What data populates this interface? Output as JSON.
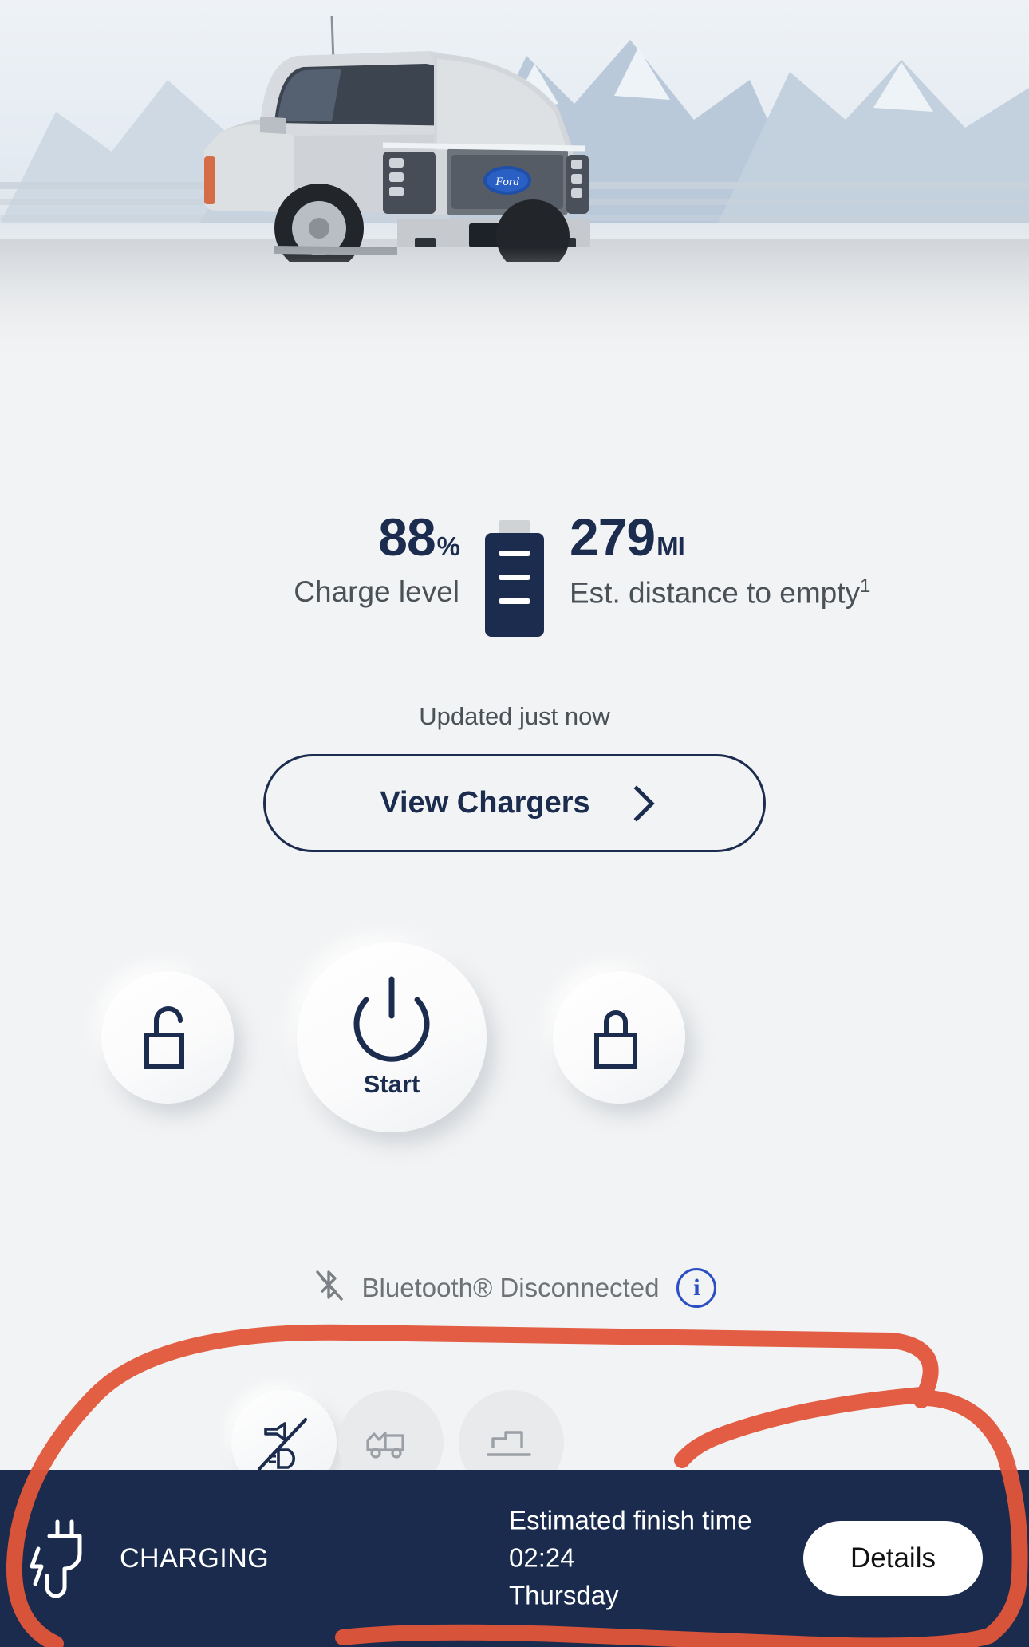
{
  "app": {
    "accent_navy": "#1b2c4f",
    "bar_navy": "#1a2b4d",
    "annotation_color": "#e2563a",
    "info_blue": "#2b4ec4",
    "page_bg": "#f2f3f4"
  },
  "hero": {
    "vehicle": "Ford F-150 Lightning pickup truck, silver, mountains background",
    "image_name": "vehicle-hero-image"
  },
  "status": {
    "charge_value": "88",
    "charge_unit": "%",
    "charge_label": "Charge level",
    "range_value": "279",
    "range_unit": "MI",
    "range_label": "Est. distance to empty",
    "range_footnote": "1",
    "battery_icon": "battery-icon",
    "updated_text": "Updated just now"
  },
  "chargers": {
    "label": "View Chargers",
    "chevron_icon": "chevron-right-icon"
  },
  "primary_actions": [
    {
      "name": "unlock",
      "icon": "unlock-icon",
      "label": ""
    },
    {
      "name": "start",
      "icon": "power-icon",
      "label": "Start"
    },
    {
      "name": "lock",
      "icon": "lock-icon",
      "label": ""
    }
  ],
  "bluetooth": {
    "icon": "bluetooth-disconnected-icon",
    "text": "Bluetooth® Disconnected",
    "info_icon": "info-icon",
    "info_glyph": "i"
  },
  "secondary_actions": [
    {
      "name": "horn-lights",
      "icon": "horn-lights-icon",
      "enabled": true
    },
    {
      "name": "tailgate",
      "icon": "truck-tailgate-icon",
      "enabled": false
    },
    {
      "name": "frunk",
      "icon": "truck-frunk-icon",
      "enabled": false
    }
  ],
  "charging_bar": {
    "plug_icon": "charging-plug-icon",
    "status": "CHARGING",
    "finish_caption": "Estimated finish time",
    "finish_time": "02:24",
    "finish_day": "Thursday",
    "details_label": "Details"
  }
}
